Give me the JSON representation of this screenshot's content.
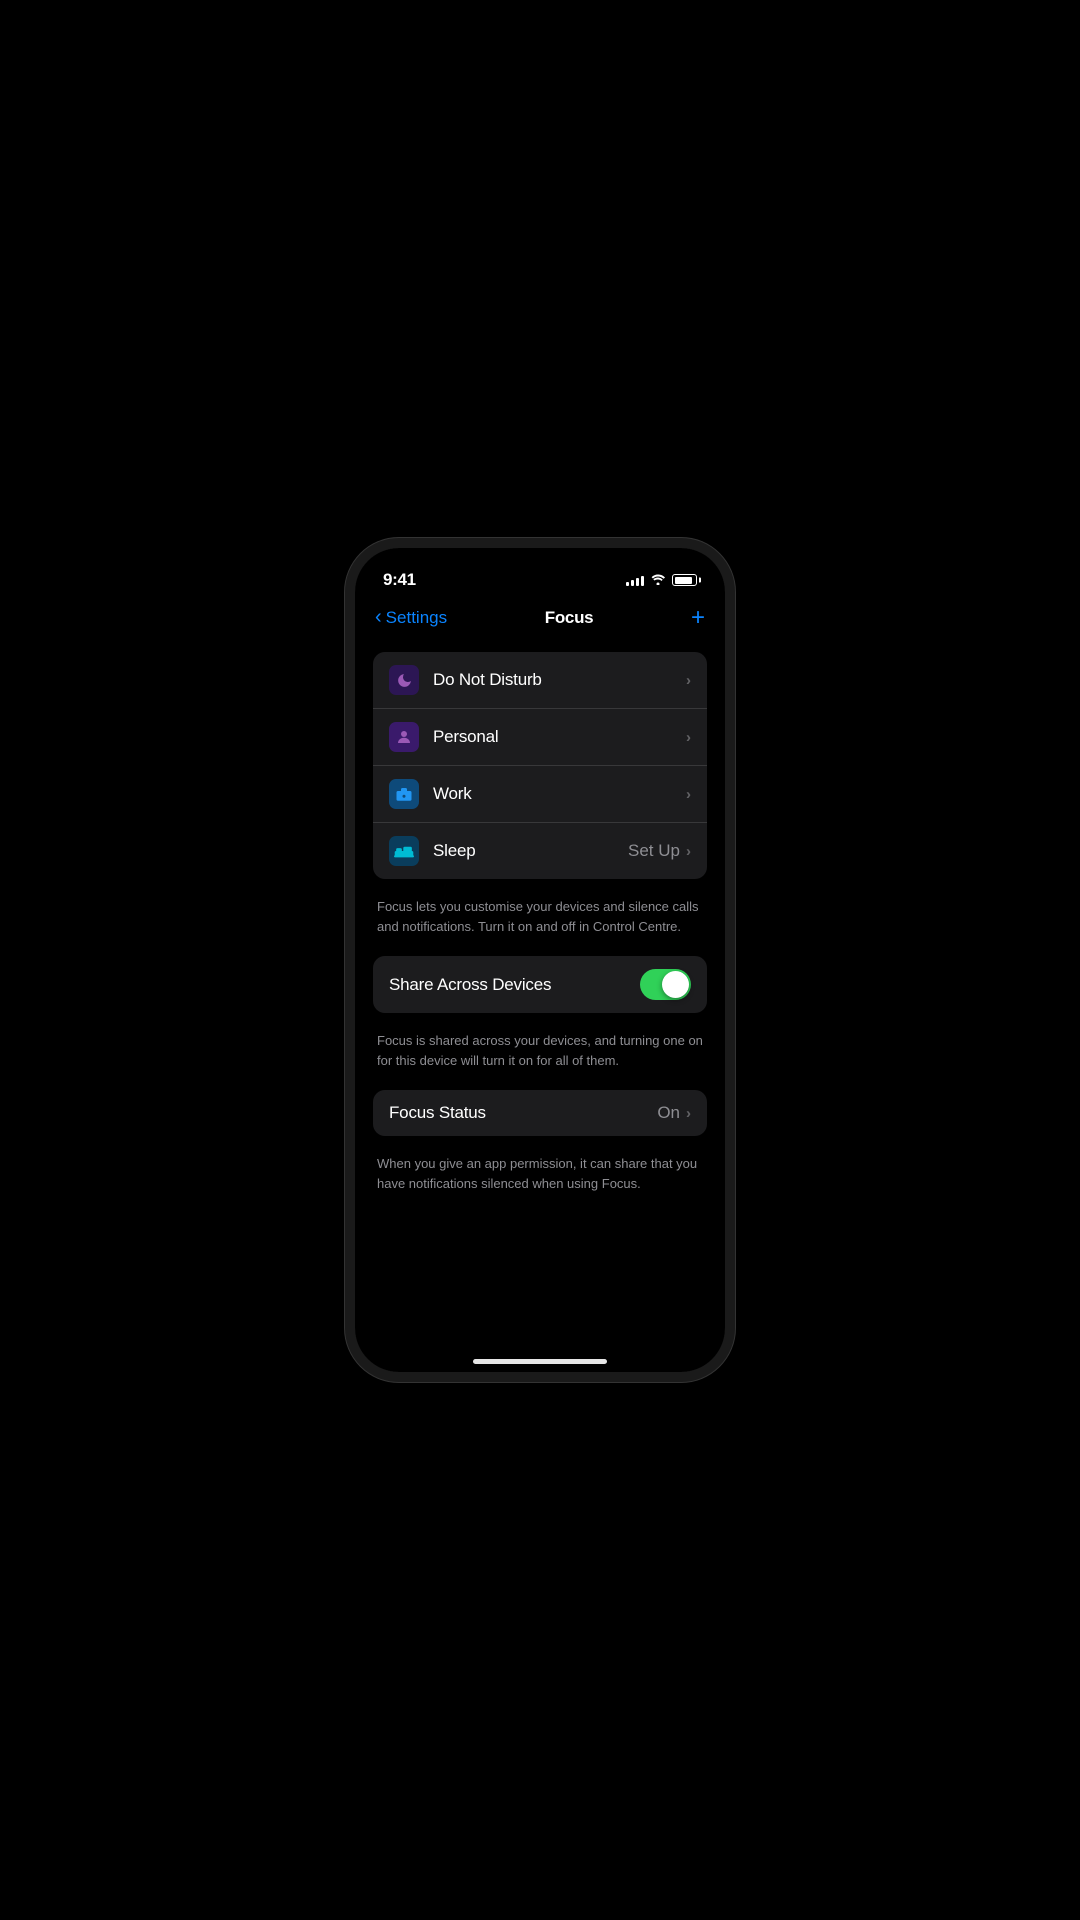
{
  "statusBar": {
    "time": "9:41",
    "signalBars": [
      4,
      6,
      8,
      10,
      12
    ],
    "batteryPercent": 85
  },
  "navigation": {
    "backLabel": "Settings",
    "title": "Focus",
    "addButton": "+"
  },
  "focusModes": [
    {
      "id": "do-not-disturb",
      "label": "Do Not Disturb",
      "iconType": "moon",
      "hasChevron": true,
      "value": ""
    },
    {
      "id": "personal",
      "label": "Personal",
      "iconType": "person",
      "hasChevron": true,
      "value": ""
    },
    {
      "id": "work",
      "label": "Work",
      "iconType": "work",
      "hasChevron": true,
      "value": ""
    },
    {
      "id": "sleep",
      "label": "Sleep",
      "iconType": "sleep",
      "hasChevron": true,
      "value": "Set Up"
    }
  ],
  "focusDescription": "Focus lets you customise your devices and silence calls and notifications. Turn it on and off in Control Centre.",
  "shareAcrossDevices": {
    "label": "Share Across Devices",
    "enabled": true,
    "description": "Focus is shared across your devices, and turning one on for this device will turn it on for all of them."
  },
  "focusStatus": {
    "label": "Focus Status",
    "value": "On",
    "hasChevron": true,
    "description": "When you give an app permission, it can share that you have notifications silenced when using Focus."
  }
}
